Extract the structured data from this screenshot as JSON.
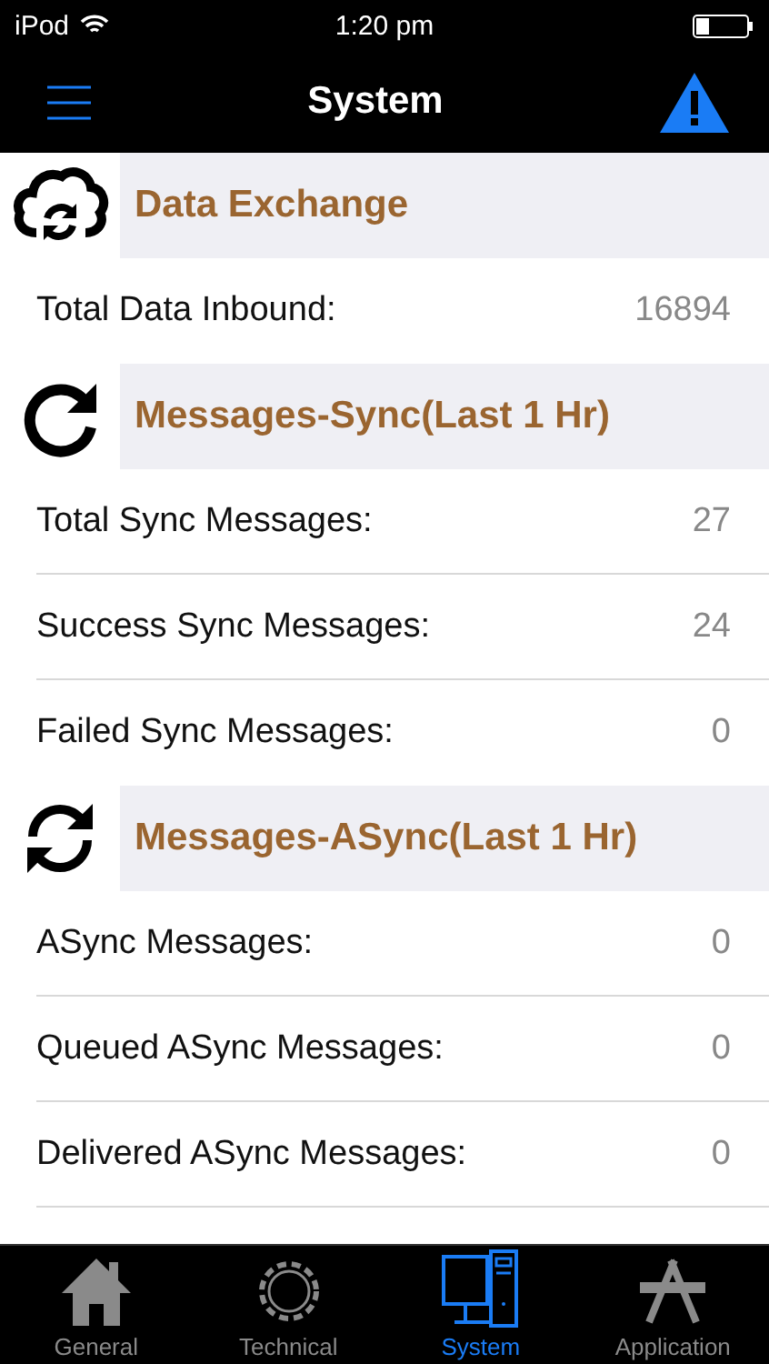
{
  "status_bar": {
    "carrier": "iPod",
    "time": "1:20 pm"
  },
  "nav": {
    "title": "System"
  },
  "sections": [
    {
      "kind": "cloud",
      "title": "Data Exchange",
      "rows": [
        {
          "label": "Total Data Inbound:",
          "value": "16894"
        }
      ]
    },
    {
      "kind": "refresh",
      "title": "Messages-Sync(Last 1 Hr)",
      "rows": [
        {
          "label": "Total Sync Messages:",
          "value": "27"
        },
        {
          "label": "Success Sync Messages:",
          "value": "24"
        },
        {
          "label": "Failed Sync Messages:",
          "value": "0"
        }
      ]
    },
    {
      "kind": "sync",
      "title": "Messages-ASync(Last 1 Hr)",
      "rows": [
        {
          "label": "ASync Messages:",
          "value": "0"
        },
        {
          "label": "Queued ASync Messages:",
          "value": "0"
        },
        {
          "label": "Delivered ASync Messages:",
          "value": "0"
        }
      ]
    }
  ],
  "tabs": [
    {
      "kind": "home",
      "label": "General",
      "selected": false
    },
    {
      "kind": "gear",
      "label": "Technical",
      "selected": false
    },
    {
      "kind": "computer",
      "label": "System",
      "selected": true
    },
    {
      "kind": "app",
      "label": "Application",
      "selected": false
    }
  ]
}
